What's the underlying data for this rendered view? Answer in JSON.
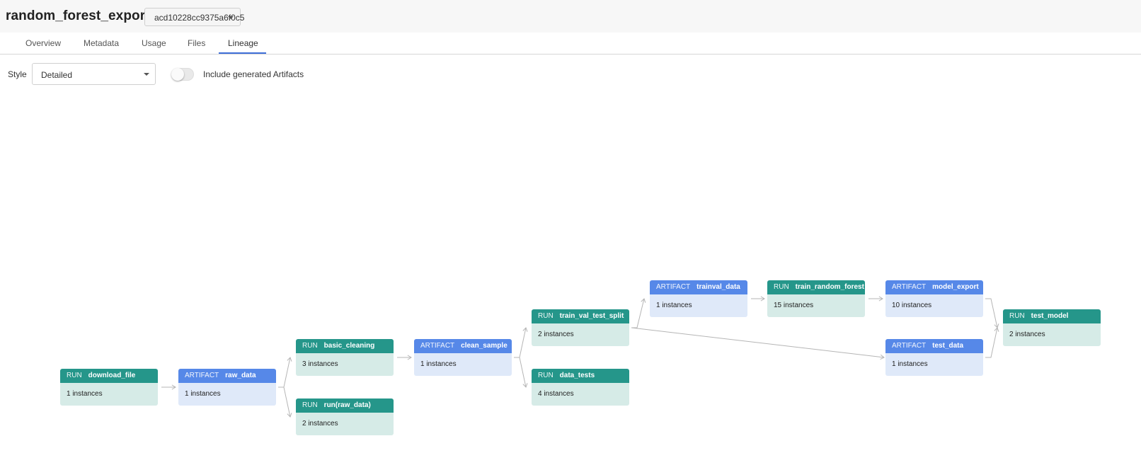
{
  "header": {
    "title": "random_forest_export",
    "version": "acd10228cc9375a6f0c5"
  },
  "tabs": [
    {
      "label": "Overview"
    },
    {
      "label": "Metadata"
    },
    {
      "label": "Usage"
    },
    {
      "label": "Files"
    },
    {
      "label": "Lineage"
    }
  ],
  "active_tab": "Lineage",
  "controls": {
    "style_label": "Style",
    "style_value": "Detailed",
    "toggle_label": "Include generated Artifacts",
    "toggle_on": false
  },
  "graph": {
    "nodes": [
      {
        "type": "RUN",
        "name": "download_file",
        "instances": "1 instances"
      },
      {
        "type": "ARTIFACT",
        "name": "raw_data",
        "instances": "1 instances"
      },
      {
        "type": "RUN",
        "name": "basic_cleaning",
        "instances": "3 instances"
      },
      {
        "type": "RUN",
        "name": "run(raw_data)",
        "instances": "2 instances"
      },
      {
        "type": "ARTIFACT",
        "name": "clean_sample",
        "instances": "1 instances"
      },
      {
        "type": "RUN",
        "name": "train_val_test_split",
        "instances": "2 instances"
      },
      {
        "type": "RUN",
        "name": "data_tests",
        "instances": "4 instances"
      },
      {
        "type": "ARTIFACT",
        "name": "trainval_data",
        "instances": "1 instances"
      },
      {
        "type": "RUN",
        "name": "train_random_forest",
        "instances": "15 instances"
      },
      {
        "type": "ARTIFACT",
        "name": "model_export",
        "instances": "10 instances"
      },
      {
        "type": "ARTIFACT",
        "name": "test_data",
        "instances": "1 instances"
      },
      {
        "type": "RUN",
        "name": "test_model",
        "instances": "2 instances"
      }
    ],
    "edges": [
      [
        "download_file",
        "raw_data"
      ],
      [
        "raw_data",
        "basic_cleaning"
      ],
      [
        "raw_data",
        "run(raw_data)"
      ],
      [
        "basic_cleaning",
        "clean_sample"
      ],
      [
        "clean_sample",
        "train_val_test_split"
      ],
      [
        "clean_sample",
        "data_tests"
      ],
      [
        "train_val_test_split",
        "trainval_data"
      ],
      [
        "train_val_test_split",
        "test_data"
      ],
      [
        "trainval_data",
        "train_random_forest"
      ],
      [
        "train_random_forest",
        "model_export"
      ],
      [
        "model_export",
        "test_model"
      ],
      [
        "test_data",
        "test_model"
      ]
    ],
    "colors": {
      "run_header": "#25968a",
      "run_body": "#d6ebe7",
      "artifact_header": "#5688e8",
      "artifact_body": "#dfe9f9",
      "edge": "#b5b5b5",
      "tab_accent": "#3e6fd8"
    }
  }
}
